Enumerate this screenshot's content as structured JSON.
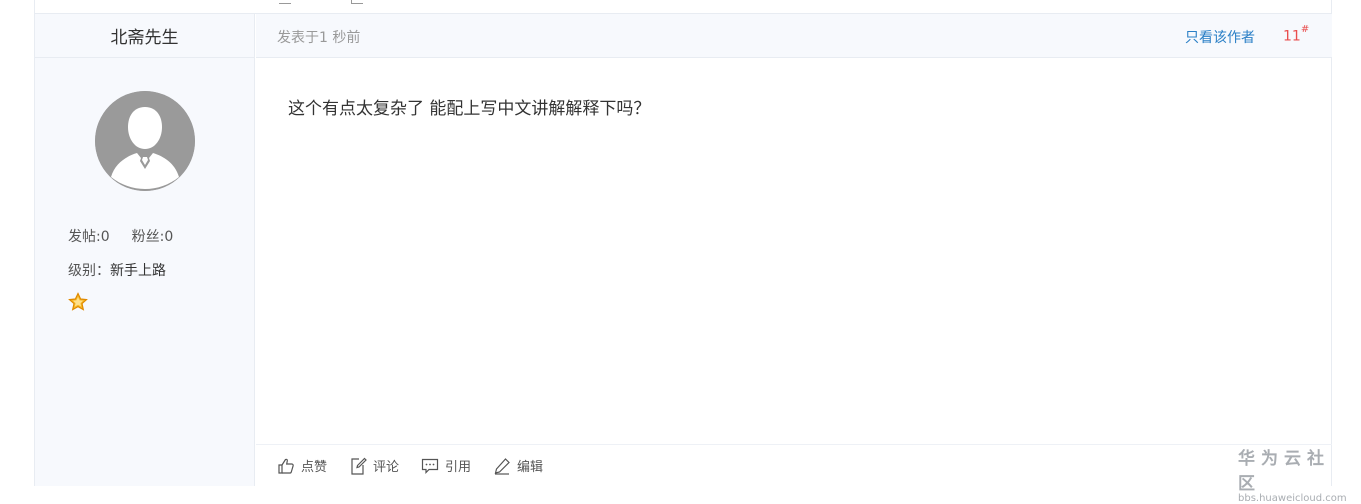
{
  "author": {
    "name": "北斋先生"
  },
  "stats": {
    "posts": "发帖:0",
    "fans": "粉丝:0"
  },
  "level": {
    "label": "级别：",
    "value": "新手上路"
  },
  "meta": {
    "posted": "发表于1 秒前",
    "author_only": "只看该作者",
    "floor": "11",
    "floor_mark": "#"
  },
  "post": {
    "content": "这个有点太复杂了 能配上写中文讲解解释下吗？"
  },
  "actions": {
    "like": "点赞",
    "comment": "评论",
    "quote": "引用",
    "edit": "编辑"
  },
  "watermark": {
    "cn": "华为云社区",
    "en": "bbs.huaweicloud.com"
  },
  "colors": {
    "link": "#2a7fc6",
    "floor": "#e94e4e",
    "sidebar_bg": "#f7f9fd",
    "avatar": "#9a9a9a",
    "star": "#f5a623"
  },
  "icons": {
    "like": "thumbs-up-icon",
    "comment": "comment-edit-icon",
    "quote": "chat-bubble-icon",
    "edit": "pen-icon",
    "star": "star-icon"
  }
}
